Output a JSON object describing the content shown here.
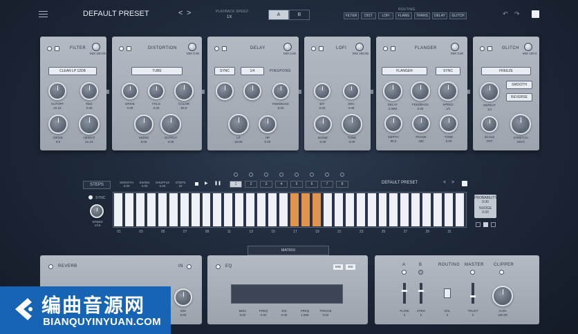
{
  "header": {
    "preset_name": "DEFAULT PRESET",
    "prev_arrow": "<",
    "next_arrow": ">",
    "playback_speed_label": "PLAYBACK SPEED",
    "playback_speed_value": "1X",
    "ab": [
      "A",
      "B"
    ],
    "routing_label": "ROUTING",
    "order": [
      "FILTER",
      "DIST",
      "LOFI",
      "FLANG",
      "TRANS",
      "DELAY",
      "GLITCH"
    ]
  },
  "modules": [
    {
      "title": "FILTER",
      "mix_label": "MIX 100.00",
      "select": "CLEAN LP 12DB",
      "knobs": [
        {
          "label": "CUTOFF",
          "value": "22.1K"
        },
        {
          "label": "RES",
          "value": "0.00"
        },
        {
          "label": "DRIVE",
          "value": "0.0"
        },
        {
          "label": "HEIGHT",
          "value": "21.1K"
        }
      ]
    },
    {
      "title": "DISTORTION",
      "mix_label": "MIX 0.00",
      "select": "TUBE",
      "knobs": [
        {
          "label": "DRIVE",
          "value": "0.00"
        },
        {
          "label": "FOLD",
          "value": "0.00"
        },
        {
          "label": "COLOR",
          "value": "50.0"
        },
        {
          "label": "MONO",
          "value": "0.00"
        },
        {
          "label": "OUTPUT",
          "value": "0.00"
        }
      ]
    },
    {
      "title": "DELAY",
      "mix_label": "MIX 0.00",
      "buttons": [
        "SYNC",
        "1/4",
        "PINGPONG"
      ],
      "knobs": [
        {
          "label": "TIME",
          "value": ""
        },
        {
          "label": "WIDTH",
          "value": ""
        },
        {
          "label": "FEEDBACK",
          "value": "0.00"
        },
        {
          "label": "LP",
          "value": "19.0K"
        },
        {
          "label": "HP",
          "value": "0.00"
        }
      ]
    },
    {
      "title": "LOFI",
      "mix_label": "MIX 100.00",
      "knobs": [
        {
          "label": "BIT",
          "value": "0.00"
        },
        {
          "label": "SRC",
          "value": "0.00"
        },
        {
          "label": "NOISE",
          "value": "0.00"
        },
        {
          "label": "TONE",
          "value": "0.00"
        }
      ]
    },
    {
      "title": "FLANGER",
      "mix_label": "MIX 0.00",
      "select": "FLANGER",
      "button": "SYNC",
      "knobs": [
        {
          "label": "DELAY",
          "value": "2.0MS"
        },
        {
          "label": "FEEDBACK",
          "value": "0.00"
        },
        {
          "label": "SPEED",
          "value": "1/4"
        },
        {
          "label": "DEPTH",
          "value": "80.0"
        },
        {
          "label": "PHASE",
          "value": "180"
        },
        {
          "label": "TONE",
          "value": "0.00"
        }
      ]
    },
    {
      "title": "GLITCH",
      "mix_label": "MIX 100.0",
      "select": "FREEZE",
      "buttons": [
        "SMOOTH",
        "REVERSE"
      ],
      "knobs": [
        {
          "label": "REPEAT",
          "value": "1/4"
        },
        {
          "label": "SCALE",
          "value": "OFF"
        },
        {
          "label": "STRETCH",
          "value": "100.0"
        }
      ]
    }
  ],
  "sequencer": {
    "steps_label": "STEPS",
    "params": [
      {
        "label": "SMOOTH",
        "value": "0.00"
      },
      {
        "label": "SWING",
        "value": "0.00"
      },
      {
        "label": "SHUFFLE",
        "value": "0.00"
      },
      {
        "label": "STEPS",
        "value": "32"
      }
    ],
    "pattern_buttons": [
      "1",
      "2",
      "3",
      "4",
      "5",
      "6",
      "7",
      "8"
    ],
    "preset_name": "DEFAULT PRESET",
    "sync_label": "SYNC",
    "speed_label": "SPEED",
    "speed_value": "1/16",
    "side": {
      "probability_label": "PROBABILITY",
      "probability_value": "0.00",
      "nudge_label": "NUDGE",
      "nudge_value": "0.00"
    },
    "step_numbers": [
      "01",
      "03",
      "05",
      "07",
      "09",
      "11",
      "13",
      "15",
      "17",
      "19",
      "21",
      "23",
      "25",
      "27",
      "29",
      "31"
    ],
    "bar_count": 32,
    "highlighted_steps": [
      17,
      18,
      19
    ]
  },
  "matrix_tab": "MATRIX",
  "reverb": {
    "title": "REVERB",
    "in_label": "IN",
    "mix_label": "MIX",
    "mix_value": "0.00"
  },
  "eq": {
    "title": "EQ",
    "tags": [
      "MID",
      "SID"
    ],
    "knobs": [
      {
        "label": "MID1",
        "value": "0.00"
      },
      {
        "label": "FREQ",
        "value": "0.00"
      },
      {
        "label": "SID",
        "value": "0.00"
      },
      {
        "label": "FREQ",
        "value": "1.00K"
      },
      {
        "label": "TRIGGE",
        "value": "0.00"
      }
    ]
  },
  "master": {
    "a": "A",
    "b": "B",
    "routing": "ROUTING",
    "master": "MASTER",
    "clipper": "CLIPPER",
    "slider_labels": [
      {
        "label": "FLOW",
        "value": "0"
      },
      {
        "label": "STER",
        "value": "0"
      },
      {
        "label": "SOL",
        "value": "0"
      },
      {
        "label": "TRUST",
        "value": "0"
      }
    ],
    "gain_label": "GAIN",
    "gain_value": "100.00"
  },
  "watermark": {
    "cn": "编曲音源网",
    "en": "BIANQUYINYUAN.COM"
  },
  "colors": {
    "accent": "#e0944d",
    "panel": "#b4bac3",
    "background": "#1f2a3b",
    "watermark": "#1864b4"
  }
}
